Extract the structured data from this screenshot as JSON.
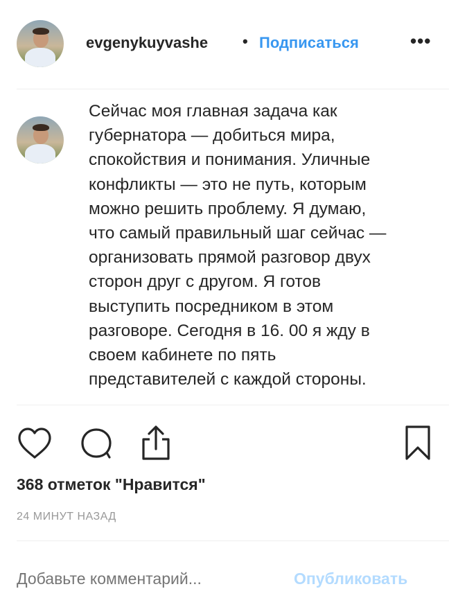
{
  "post": {
    "username": "evgenykuyvashe",
    "separator": "•",
    "follow_label": "Подписаться",
    "more_label": "•••",
    "caption_lines": [
      "Сейчас моя главная задача как",
      "губернатора — добиться мира,",
      "спокойствия и понимания. Уличные",
      "конфликты — это не путь, которым",
      "можно решить проблему. Я думаю,",
      "что самый правильный шаг сейчас —",
      "организовать прямой разговор двух",
      "сторон друг с другом. Я готов",
      "выступить посредником в этом",
      "разговоре. Сегодня в 16. 00 я жду в",
      "своем кабинете по пять",
      "представителей с каждой стороны."
    ],
    "likes_text": "368 отметок \"Нравится\"",
    "timestamp": "24 МИНУТ НАЗАД"
  },
  "comment": {
    "placeholder": "Добавьте комментарий...",
    "publish_label": "Опубликовать"
  },
  "icons": {
    "like": "heart-icon",
    "comment": "comment-icon",
    "share": "share-icon",
    "save": "bookmark-icon"
  },
  "colors": {
    "link": "#3897f0",
    "publish_disabled": "#b3dbff",
    "muted": "#999999",
    "text": "#262626"
  }
}
